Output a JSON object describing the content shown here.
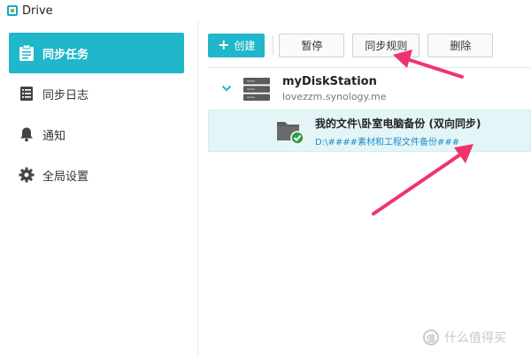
{
  "window": {
    "title": "Drive"
  },
  "sidebar": {
    "items": [
      {
        "label": "同步任务",
        "icon": "clipboard-icon",
        "active": true
      },
      {
        "label": "同步日志",
        "icon": "log-list-icon",
        "active": false
      },
      {
        "label": "通知",
        "icon": "bell-icon",
        "active": false
      },
      {
        "label": "全局设置",
        "icon": "gear-icon",
        "active": false
      }
    ]
  },
  "toolbar": {
    "create_label": "创建",
    "pause_label": "暂停",
    "sync_rules_label": "同步规则",
    "delete_label": "删除"
  },
  "server": {
    "name": "myDiskStation",
    "host": "lovezzm.synology.me"
  },
  "task": {
    "name": "我的文件\\卧室电脑备份 (双向同步)",
    "local_path": "D:\\####素材和工程文件备份###",
    "status": "synced"
  },
  "watermark": {
    "text": "什么值得买",
    "logo_glyph": "值"
  },
  "colors": {
    "accent": "#1fb7c9",
    "selected_row": "#e4f5f8",
    "path_link": "#1a8fc7",
    "status_ok": "#2e9e46",
    "annotation_arrow": "#f0336f"
  }
}
